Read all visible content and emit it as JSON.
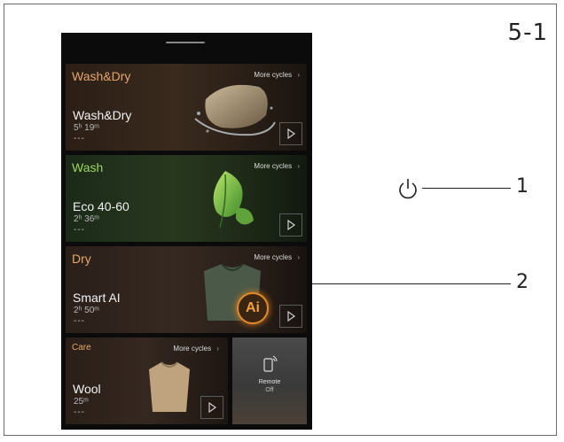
{
  "figure_label": "5-1",
  "callouts": [
    "1",
    "2"
  ],
  "cards": {
    "wash_dry": {
      "category": "Wash&Dry",
      "more": "More cycles",
      "name": "Wash&Dry",
      "time": "5ʰ 19ᵐ",
      "extra": "---"
    },
    "wash": {
      "category": "Wash",
      "more": "More cycles",
      "name": "Eco 40-60",
      "time": "2ʰ 36ᵐ",
      "extra": "---"
    },
    "dry": {
      "category": "Dry",
      "more": "More cycles",
      "name": "Smart AI",
      "time": "2ʰ 50ᵐ",
      "extra": "---",
      "badge": "Ai"
    },
    "care": {
      "category": "Care",
      "more": "More cycles",
      "name": "Wool",
      "time": "25ᵐ",
      "extra": "---"
    },
    "remote": {
      "label": "Remote",
      "status": "Off"
    }
  },
  "colors": {
    "wash_dry_accent": "#e6a66a",
    "wash_accent": "#9fd45a",
    "dry_accent": "#e6a66a",
    "care_accent": "#e6a66a"
  },
  "icons": {
    "power": "power-icon",
    "play": "play-icon",
    "chevron": "chevron-right-icon",
    "remote": "remote-phone-icon"
  }
}
